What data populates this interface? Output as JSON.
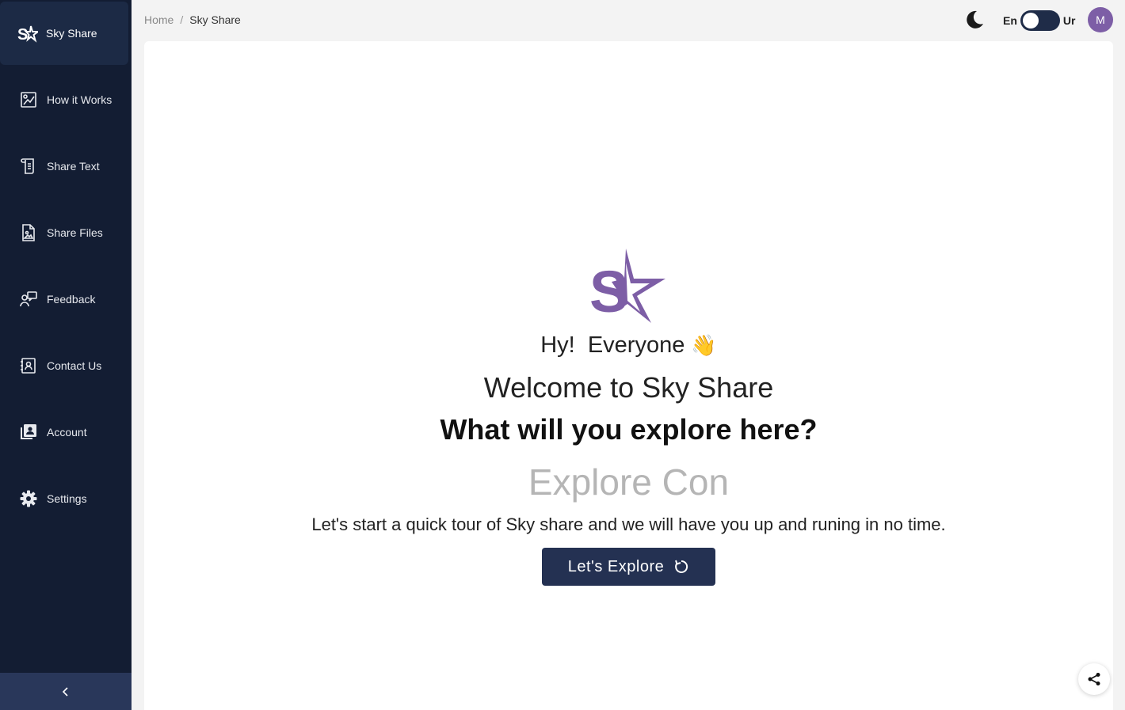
{
  "sidebar": {
    "brand": "Sky Share",
    "items": [
      {
        "label": "How it Works",
        "icon": "how-it-works-icon"
      },
      {
        "label": "Share Text",
        "icon": "scroll-icon"
      },
      {
        "label": "Share Files",
        "icon": "image-file-icon"
      },
      {
        "label": "Feedback",
        "icon": "feedback-icon"
      },
      {
        "label": "Contact Us",
        "icon": "contact-card-icon"
      },
      {
        "label": "Account",
        "icon": "account-icon"
      },
      {
        "label": "Settings",
        "icon": "gear-icon"
      }
    ],
    "collapse_symbol": "<"
  },
  "header": {
    "breadcrumb": {
      "home": "Home",
      "separator": "/",
      "current": "Sky Share"
    },
    "lang_left": "En",
    "lang_right": "Ur",
    "avatar_initial": "M"
  },
  "hero": {
    "greeting": "Hy!  Everyone",
    "wave_emoji": "👋",
    "welcome": "Welcome to Sky Share",
    "question": "What will you explore here?",
    "typing_text": "Explore Con",
    "tagline": "Let's start a quick tour of Sky share and we will have you up and runing in no time.",
    "button_label": "Let's Explore"
  },
  "colors": {
    "sidebar_bg": "#131d33",
    "brand_purple": "#7d5ea6",
    "button_bg": "#243152"
  }
}
